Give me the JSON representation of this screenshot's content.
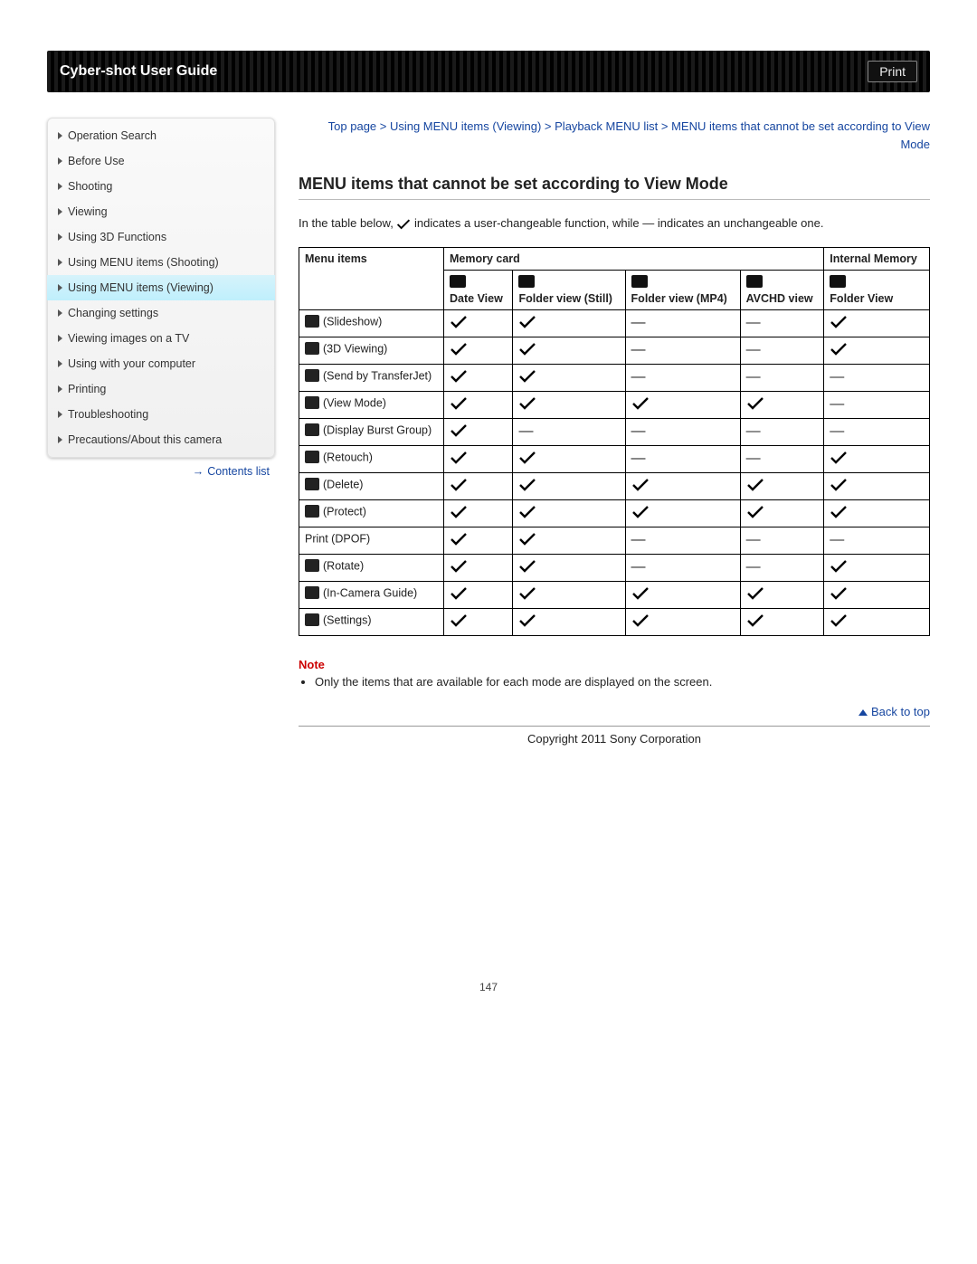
{
  "header": {
    "title": "Cyber-shot User Guide",
    "print": "Print"
  },
  "sidebar": {
    "items": [
      {
        "label": "Operation Search",
        "active": false
      },
      {
        "label": "Before Use",
        "active": false
      },
      {
        "label": "Shooting",
        "active": false
      },
      {
        "label": "Viewing",
        "active": false
      },
      {
        "label": "Using 3D Functions",
        "active": false
      },
      {
        "label": "Using MENU items (Shooting)",
        "active": false
      },
      {
        "label": "Using MENU items (Viewing)",
        "active": true
      },
      {
        "label": "Changing settings",
        "active": false
      },
      {
        "label": "Viewing images on a TV",
        "active": false
      },
      {
        "label": "Using with your computer",
        "active": false
      },
      {
        "label": "Printing",
        "active": false
      },
      {
        "label": "Troubleshooting",
        "active": false
      },
      {
        "label": "Precautions/About this camera",
        "active": false
      }
    ],
    "contents_link": "Contents list"
  },
  "breadcrumb": "Top page > Using MENU items (Viewing) > Playback MENU list > MENU items that cannot be set according to View Mode",
  "title": "MENU items that cannot be set according to View Mode",
  "intro_pre": "In the table below, ",
  "intro_post": " indicates a user-changeable function, while — indicates an unchangeable one.",
  "table": {
    "group_headers": {
      "memory_card": "Memory card",
      "internal": "Internal Memory"
    },
    "menu_items_header": "Menu items",
    "sub_headers": [
      "Date View",
      "Folder view (Still)",
      "Folder view (MP4)",
      "AVCHD view",
      "Folder View"
    ],
    "rows": [
      {
        "label": "(Slideshow)",
        "cells": [
          "y",
          "y",
          "n",
          "n",
          "y"
        ]
      },
      {
        "label": "(3D Viewing)",
        "cells": [
          "y",
          "y",
          "n",
          "n",
          "y"
        ]
      },
      {
        "label": "(Send by TransferJet)",
        "cells": [
          "y",
          "y",
          "n",
          "n",
          "n"
        ]
      },
      {
        "label": "(View Mode)",
        "cells": [
          "y",
          "y",
          "y",
          "y",
          "n"
        ]
      },
      {
        "label": "(Display Burst Group)",
        "cells": [
          "y",
          "n",
          "n",
          "n",
          "n"
        ]
      },
      {
        "label": "(Retouch)",
        "cells": [
          "y",
          "y",
          "n",
          "n",
          "y"
        ]
      },
      {
        "label": "(Delete)",
        "cells": [
          "y",
          "y",
          "y",
          "y",
          "y"
        ]
      },
      {
        "label": "(Protect)",
        "cells": [
          "y",
          "y",
          "y",
          "y",
          "y"
        ]
      },
      {
        "label": "Print (DPOF)",
        "cells": [
          "y",
          "y",
          "n",
          "n",
          "n"
        ],
        "no_icon": true
      },
      {
        "label": "(Rotate)",
        "cells": [
          "y",
          "y",
          "n",
          "n",
          "y"
        ]
      },
      {
        "label": "(In-Camera Guide)",
        "cells": [
          "y",
          "y",
          "y",
          "y",
          "y"
        ]
      },
      {
        "label": "(Settings)",
        "cells": [
          "y",
          "y",
          "y",
          "y",
          "y"
        ]
      }
    ]
  },
  "note": {
    "heading": "Note",
    "item": "Only the items that are available for each mode are displayed on the screen."
  },
  "back_to_top": "Back to top",
  "copyright": "Copyright 2011 Sony Corporation",
  "page_number": "147"
}
